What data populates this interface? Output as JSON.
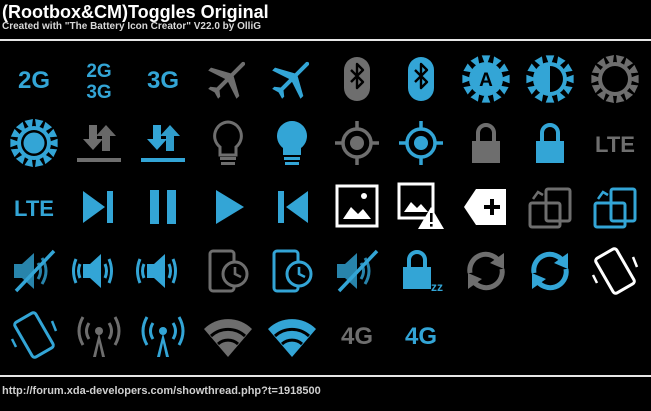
{
  "header": {
    "title": "(Rootbox&CM)Toggles Original",
    "subtitle": "Created with \"The Battery Icon Creator\" V22.0 by OlliG"
  },
  "footer": {
    "url": "http://forum.xda-developers.com/showthread.php?t=1918500"
  },
  "colors": {
    "background": "#000000",
    "accent_blue": "#33a5d6",
    "inactive_gray": "#6e6e6e",
    "white": "#ffffff"
  },
  "icons": [
    {
      "name": "2g-icon",
      "state": "on",
      "text": "2G"
    },
    {
      "name": "2g-3g-icon",
      "state": "on",
      "text": "2G",
      "text2": "3G"
    },
    {
      "name": "3g-icon",
      "state": "on",
      "text": "3G"
    },
    {
      "name": "airplane-mode-icon",
      "state": "off"
    },
    {
      "name": "airplane-mode-icon",
      "state": "on"
    },
    {
      "name": "bluetooth-icon",
      "state": "off"
    },
    {
      "name": "bluetooth-icon",
      "state": "on"
    },
    {
      "name": "auto-brightness-icon",
      "state": "on",
      "text": "A"
    },
    {
      "name": "brightness-half-icon",
      "state": "on"
    },
    {
      "name": "brightness-icon",
      "state": "off"
    },
    {
      "name": "brightness-icon",
      "state": "on"
    },
    {
      "name": "data-transfer-icon",
      "state": "off"
    },
    {
      "name": "data-transfer-icon",
      "state": "on"
    },
    {
      "name": "lightbulb-icon",
      "state": "off"
    },
    {
      "name": "lightbulb-icon",
      "state": "on"
    },
    {
      "name": "gps-location-icon",
      "state": "off"
    },
    {
      "name": "gps-location-icon",
      "state": "on"
    },
    {
      "name": "lock-icon",
      "state": "off"
    },
    {
      "name": "lock-icon",
      "state": "on"
    },
    {
      "name": "lte-icon",
      "state": "off",
      "text": "LTE"
    },
    {
      "name": "lte-icon",
      "state": "on",
      "text": "LTE"
    },
    {
      "name": "next-track-icon",
      "state": "on"
    },
    {
      "name": "pause-icon",
      "state": "on"
    },
    {
      "name": "play-icon",
      "state": "on"
    },
    {
      "name": "previous-track-icon",
      "state": "on"
    },
    {
      "name": "screenshot-icon",
      "state": "white"
    },
    {
      "name": "screenshot-warning-icon",
      "state": "white"
    },
    {
      "name": "add-tag-icon",
      "state": "white"
    },
    {
      "name": "screen-rotation-icon",
      "state": "off"
    },
    {
      "name": "screen-rotation-icon",
      "state": "on"
    },
    {
      "name": "sound-muted-icon",
      "state": "on"
    },
    {
      "name": "vibrate-sound-icon",
      "state": "on"
    },
    {
      "name": "sound-vibrate-icon",
      "state": "on"
    },
    {
      "name": "screen-timeout-icon",
      "state": "off"
    },
    {
      "name": "screen-timeout-icon",
      "state": "on"
    },
    {
      "name": "sound-muted-icon",
      "state": "on"
    },
    {
      "name": "sleep-lock-icon",
      "state": "on"
    },
    {
      "name": "sync-icon",
      "state": "off"
    },
    {
      "name": "sync-icon",
      "state": "on"
    },
    {
      "name": "vibrate-icon",
      "state": "white"
    },
    {
      "name": "vibrate-icon",
      "state": "on"
    },
    {
      "name": "wireless-tower-icon",
      "state": "off"
    },
    {
      "name": "wireless-tower-icon",
      "state": "on"
    },
    {
      "name": "wifi-icon",
      "state": "off"
    },
    {
      "name": "wifi-icon",
      "state": "on"
    },
    {
      "name": "4g-icon",
      "state": "off",
      "text": "4G"
    },
    {
      "name": "4g-icon",
      "state": "on",
      "text": "4G"
    }
  ]
}
